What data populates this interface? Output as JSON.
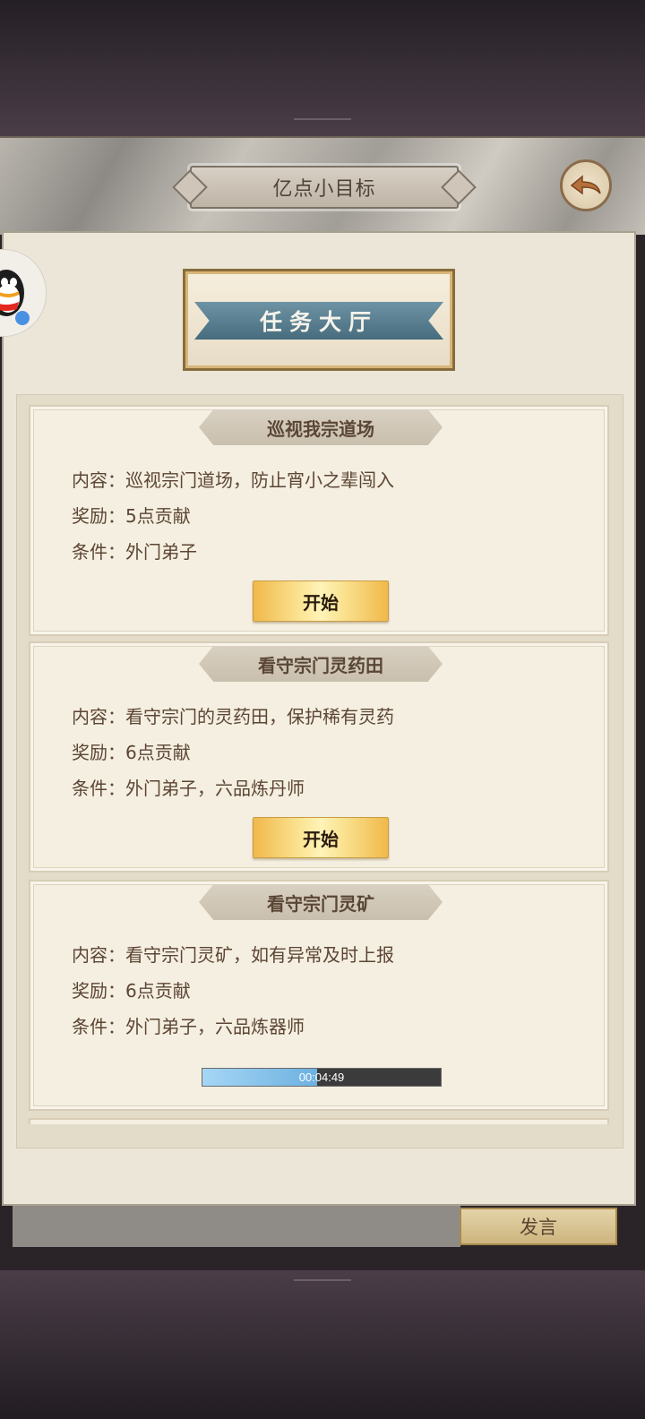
{
  "header": {
    "title": "亿点小目标",
    "back_icon": "back-arrow-icon"
  },
  "panel": {
    "plaque_title": "任务大厅"
  },
  "tasks": [
    {
      "title": "巡视我宗道场",
      "content": "内容：巡视宗门道场，防止宵小之辈闯入",
      "reward": "奖励：5点贡献",
      "condition": "条件：外门弟子",
      "action_label": "开始",
      "state": "available"
    },
    {
      "title": "看守宗门灵药田",
      "content": "内容：看守宗门的灵药田，保护稀有灵药",
      "reward": "奖励：6点贡献",
      "condition": "条件：外门弟子，六品炼丹师",
      "action_label": "开始",
      "state": "available"
    },
    {
      "title": "看守宗门灵矿",
      "content": "内容：看守宗门灵矿，如有异常及时上报",
      "reward": "奖励：6点贡献",
      "condition": "条件：外门弟子，六品炼器师",
      "timer_text": "00:04:49",
      "progress": 0.48,
      "state": "in_progress"
    }
  ],
  "chat": {
    "speak_label": "发言"
  },
  "colors": {
    "accent_gold": "#f6d774",
    "progress_blue": "#7fc1ea",
    "ribbon_blue": "#4f7688"
  }
}
